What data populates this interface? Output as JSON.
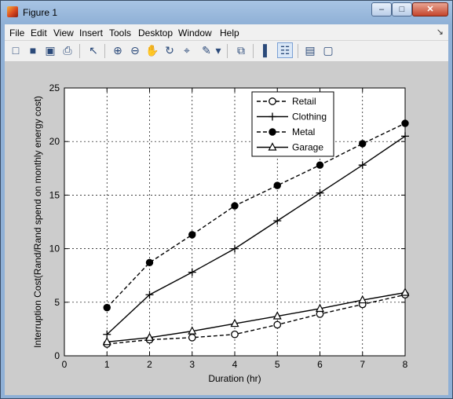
{
  "window": {
    "title": "Figure 1",
    "buttons": {
      "minimize": "–",
      "maximize": "□",
      "close": "✕"
    }
  },
  "menubar": {
    "items": [
      "File",
      "Edit",
      "View",
      "Insert",
      "Tools",
      "Desktop",
      "Window",
      "Help"
    ]
  },
  "toolbar": {
    "items": [
      {
        "name": "new-figure-icon",
        "glyph": "□"
      },
      {
        "name": "open-file-icon",
        "glyph": "■"
      },
      {
        "name": "save-icon",
        "glyph": "▣"
      },
      {
        "name": "print-icon",
        "glyph": "⎙"
      },
      {
        "name": "edit-plot-arrow-icon",
        "glyph": "↖"
      },
      {
        "name": "zoom-in-icon",
        "glyph": "⊕"
      },
      {
        "name": "zoom-out-icon",
        "glyph": "⊖"
      },
      {
        "name": "pan-hand-icon",
        "glyph": "✋"
      },
      {
        "name": "rotate-3d-icon",
        "glyph": "↻"
      },
      {
        "name": "data-cursor-icon",
        "glyph": "⌖"
      },
      {
        "name": "brush-icon",
        "glyph": "✎"
      },
      {
        "name": "brush-dropdown-icon",
        "glyph": "▾"
      },
      {
        "name": "link-plot-icon",
        "glyph": "⧉"
      },
      {
        "name": "insert-colorbar-icon",
        "glyph": "▌"
      },
      {
        "name": "insert-legend-icon",
        "glyph": "☷"
      },
      {
        "name": "hide-plot-tools-icon",
        "glyph": "▤"
      },
      {
        "name": "show-plot-tools-icon",
        "glyph": "▢"
      }
    ]
  },
  "chart_data": {
    "type": "line",
    "title": "",
    "xlabel": "Duration (hr)",
    "ylabel": "Interruption Cost(Rand/Rand spend on monthly energy cost)",
    "xlim": [
      0,
      8
    ],
    "ylim": [
      0,
      25
    ],
    "xticks": [
      0,
      1,
      2,
      3,
      4,
      5,
      6,
      7,
      8
    ],
    "yticks": [
      0,
      5,
      10,
      15,
      20,
      25
    ],
    "grid": true,
    "legend_position": "top-right",
    "x": [
      1,
      2,
      3,
      4,
      5,
      6,
      7,
      8
    ],
    "series": [
      {
        "name": "Retail",
        "marker": "open-circle",
        "line": "dashed",
        "values": [
          1.1,
          1.5,
          1.7,
          2.0,
          2.9,
          3.9,
          4.8,
          5.7
        ]
      },
      {
        "name": "Clothing",
        "marker": "plus",
        "line": "solid",
        "values": [
          2.0,
          5.7,
          7.8,
          10.0,
          12.6,
          15.2,
          17.8,
          20.5
        ]
      },
      {
        "name": "Metal",
        "marker": "filled-circle",
        "line": "dashed",
        "values": [
          4.5,
          8.7,
          11.3,
          14.0,
          15.9,
          17.8,
          19.8,
          21.7
        ]
      },
      {
        "name": "Garage",
        "marker": "open-triangle",
        "line": "solid",
        "values": [
          1.3,
          1.7,
          2.3,
          3.0,
          3.7,
          4.4,
          5.2,
          5.9
        ]
      }
    ]
  }
}
